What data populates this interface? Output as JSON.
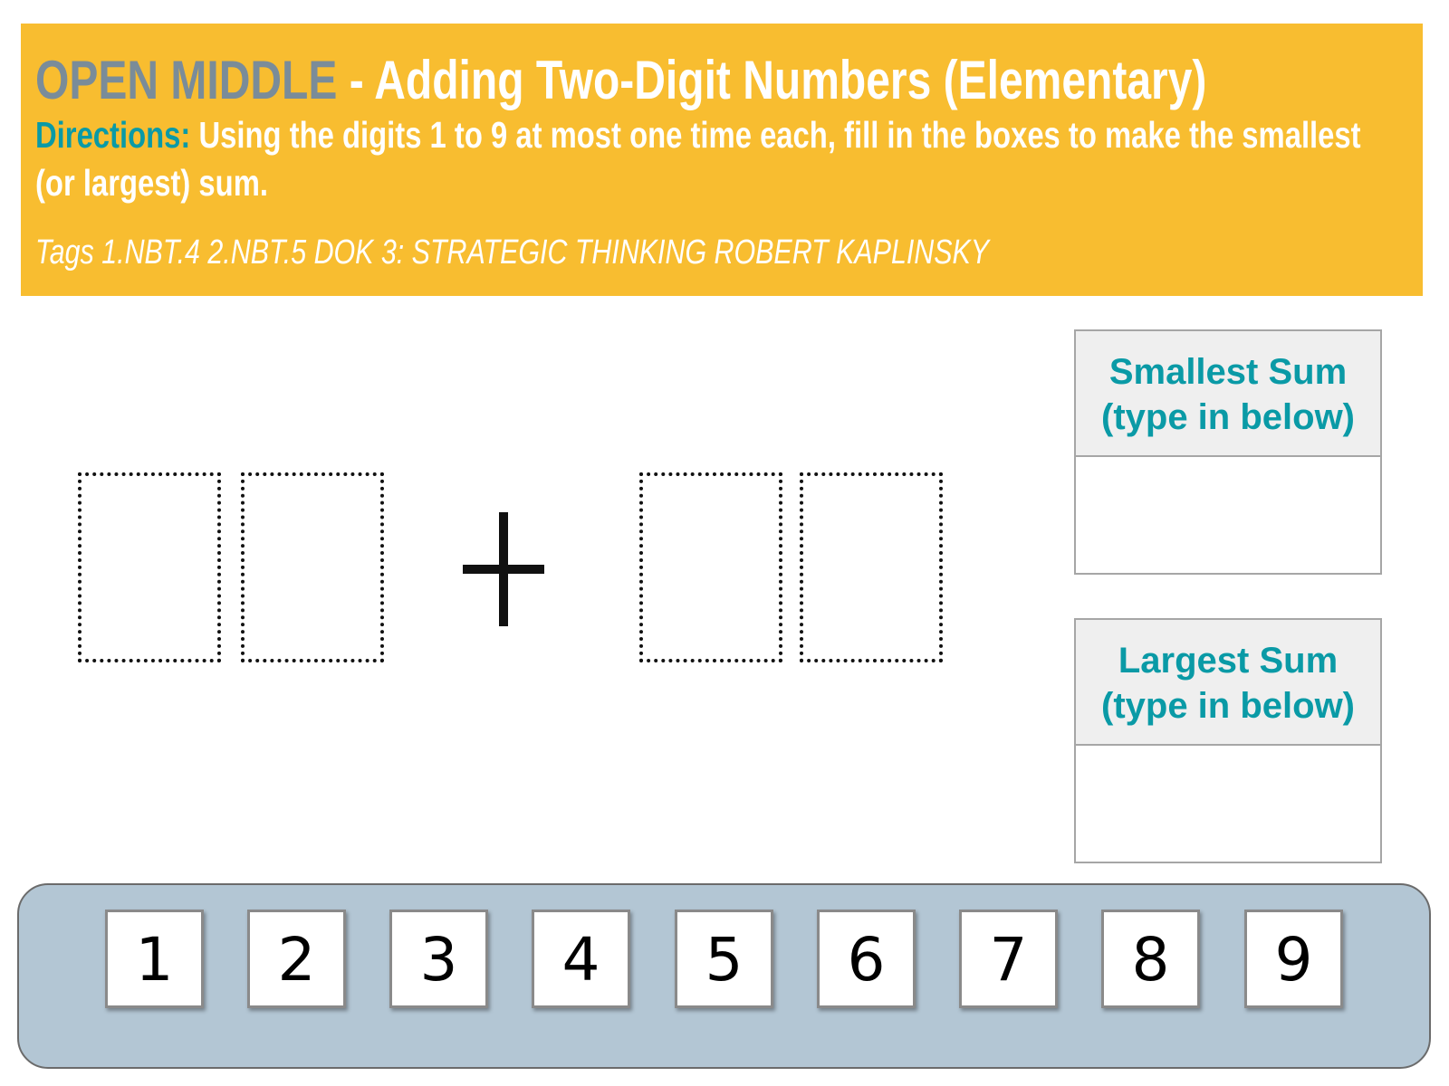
{
  "header": {
    "brand": "OPEN MIDDLE",
    "title": " - Adding Two-Digit Numbers (Elementary)",
    "directions_label": "Directions:",
    "directions_text": " Using the digits 1 to 9 at most one time each, fill in the boxes to make the smallest",
    "directions_text_2": "(or largest) sum.",
    "tags": "Tags 1.NBT.4 2.NBT.5 DOK 3: STRATEGIC THINKING ROBERT KAPLINSKY"
  },
  "operator": "plus",
  "answers": {
    "smallest": {
      "line1": "Smallest Sum",
      "line2": "(type in below)",
      "value": ""
    },
    "largest": {
      "line1": "Largest Sum",
      "line2": "(type in below)",
      "value": ""
    }
  },
  "digits": [
    "1",
    "2",
    "3",
    "4",
    "5",
    "6",
    "7",
    "8",
    "9"
  ],
  "colors": {
    "banner": "#f8bd30",
    "brand": "#7a8c99",
    "accent": "#0a9aa6",
    "tray": "#b3c6d4"
  }
}
